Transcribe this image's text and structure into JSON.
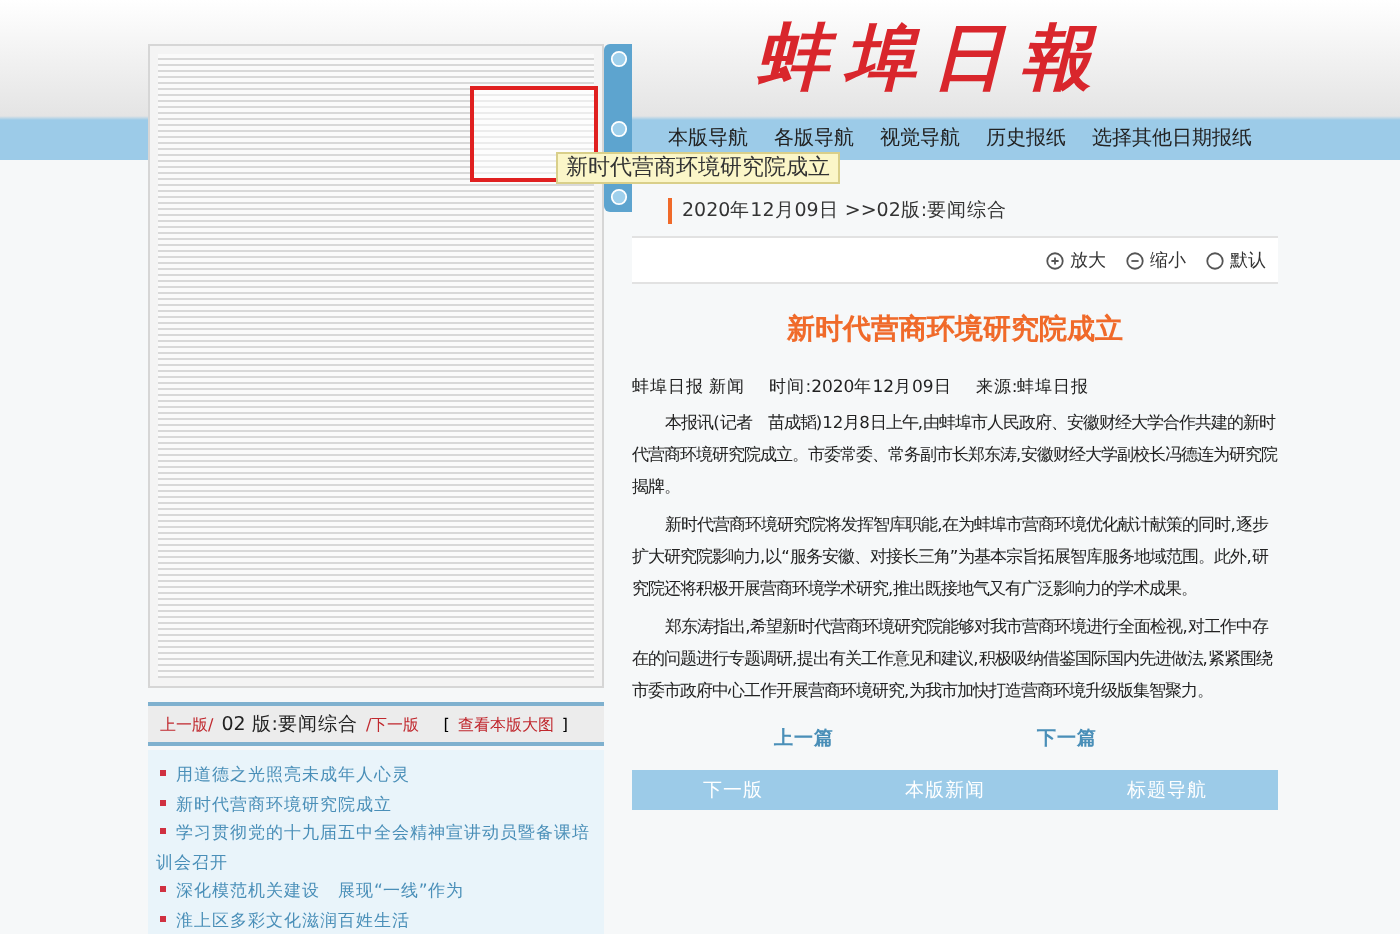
{
  "newspaper_page": {
    "highlight_tooltip": "新时代营商环境研究院成立"
  },
  "page_nav": {
    "prev": "上一版/",
    "current": "02 版:要闻综合",
    "next": "/下一版",
    "bracket_open": "[",
    "view_large": "查看本版大图",
    "bracket_close": "]"
  },
  "headlines": [
    "用道德之光照亮未成年人心灵",
    "新时代营商环境研究院成立",
    "学习贯彻党的十九届五中全会精神宣讲动员暨备课培训会召开",
    "深化模范机关建设　展现“一线”作为",
    "淮上区多彩文化滋润百姓生活"
  ],
  "nav": {
    "items": [
      "本版导航",
      "各版导航",
      "视觉导航",
      "历史报纸",
      "选择其他日期报纸"
    ]
  },
  "logo": "蚌埠日報",
  "breadcrumb": "2020年12月09日 >>02版:要闻综合",
  "font_controls": [
    {
      "label": "放大",
      "kind": "plus"
    },
    {
      "label": "缩小",
      "kind": "minus"
    },
    {
      "label": "默认",
      "kind": "default"
    }
  ],
  "article": {
    "title": "新时代营商环境研究院成立",
    "meta": [
      "蚌埠日报 新闻",
      "时间:2020年12月09日",
      "来源:蚌埠日报"
    ],
    "paragraphs": [
      "本报讯(记者　苗成韬)12月8日上午,由蚌埠市人民政府、安徽财经大学合作共建的新时代营商环境研究院成立。市委常委、常务副市长郑东涛,安徽财经大学副校长冯德连为研究院揭牌。",
      "新时代营商环境研究院将发挥智库职能,在为蚌埠市营商环境优化献计献策的同时,逐步扩大研究院影响力,以“服务安徽、对接长三角”为基本宗旨拓展智库服务地域范围。此外,研究院还将积极开展营商环境学术研究,推出既接地气又有广泛影响力的学术成果。",
      "郑东涛指出,希望新时代营商环境研究院能够对我市营商环境进行全面检视,对工作中存在的问题进行专题调研,提出有关工作意见和建议,积极吸纳借鉴国际国内先进做法,紧紧围绕市委市政府中心工作开展营商环境研究,为我市加快打造营商环境升级版集智聚力。"
    ]
  },
  "article_links": [
    "上一篇",
    "下一篇"
  ],
  "bottom_bar": [
    "下一版",
    "本版新闻",
    "标题导航"
  ]
}
